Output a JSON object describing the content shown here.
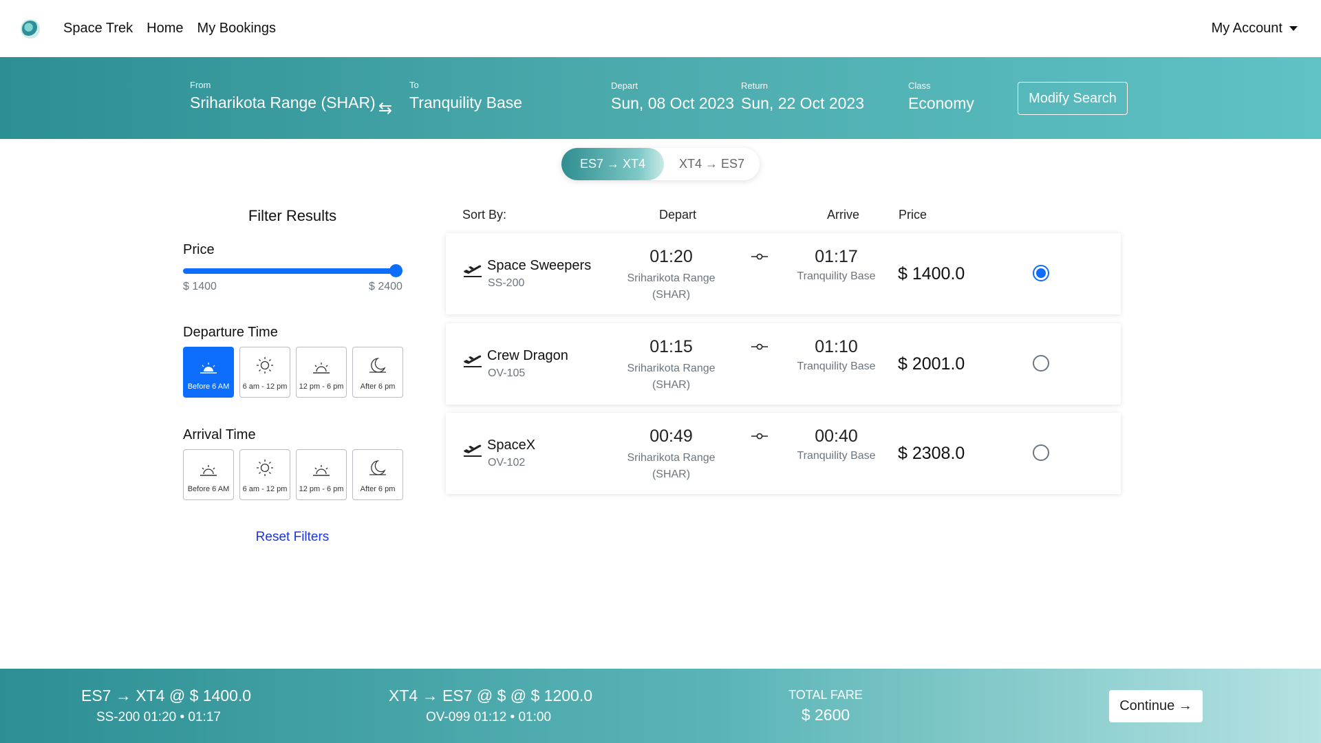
{
  "navbar": {
    "brand": "Space Trek",
    "links": [
      "Home",
      "My Bookings"
    ],
    "account": "My Account"
  },
  "search": {
    "from_label": "From",
    "from_value": "Sriharikota Range (SHAR)",
    "to_label": "To",
    "to_value": "Tranquility Base",
    "depart_label": "Depart",
    "depart_value": "Sun, 08 Oct 2023",
    "return_label": "Return",
    "return_value": "Sun, 22 Oct 2023",
    "class_label": "Class",
    "class_value": "Economy",
    "modify_label": "Modify Search",
    "swap_glyph": "⇆"
  },
  "legs": {
    "active": "ES7 → XT4",
    "inactive": "XT4 → ES7"
  },
  "filters": {
    "title": "Filter Results",
    "price_heading": "Price",
    "price_min": "$ 1400",
    "price_max": "$ 2400",
    "price_slider_value_fraction": 1.0,
    "departure_heading": "Departure Time",
    "arrival_heading": "Arrival Time",
    "departure_slots": [
      "Before 6 AM",
      "6 am - 12 pm",
      "12 pm - 6 pm",
      "After 6 pm"
    ],
    "arrival_slots": [
      "Before 6 AM",
      "6 am - 12 pm",
      "12 pm - 6 pm",
      "After 6 pm"
    ],
    "departure_selected_index": 0,
    "reset_label": "Reset Filters"
  },
  "results_header": {
    "sort_by": "Sort By:",
    "depart": "Depart",
    "arrive": "Arrive",
    "price": "Price"
  },
  "flights": [
    {
      "airline": "Space Sweepers",
      "code": "SS-200",
      "depart_time": "01:20",
      "depart_place": "Sriharikota Range (SHAR)",
      "arrive_time": "01:17",
      "arrive_place": "Tranquility Base",
      "price": "$ 1400.0",
      "selected": true
    },
    {
      "airline": "Crew Dragon",
      "code": "OV-105",
      "depart_time": "01:15",
      "depart_place": "Sriharikota Range (SHAR)",
      "arrive_time": "01:10",
      "arrive_place": "Tranquility Base",
      "price": "$ 2001.0",
      "selected": false
    },
    {
      "airline": "SpaceX",
      "code": "OV-102",
      "depart_time": "00:49",
      "depart_place": "Sriharikota Range (SHAR)",
      "arrive_time": "00:40",
      "arrive_place": "Tranquility Base",
      "price": "$ 2308.0",
      "selected": false
    }
  ],
  "summary": {
    "outbound_line": "ES7 → XT4  @  $ 1400.0",
    "outbound_details": "SS-200     01:20 • 01:17",
    "return_line": "XT4 → ES7   @ $   @ $ 1200.0",
    "return_details": "OV-099     01:12 • 01:00",
    "total_label": "TOTAL FARE",
    "total_value": "$ 2600",
    "continue_label": "Continue →"
  },
  "colors": {
    "teal_dark": "#2c8f94",
    "teal_light": "#5fc2c5",
    "primary_blue": "#0d6efd",
    "link_blue": "#1a35e0"
  }
}
